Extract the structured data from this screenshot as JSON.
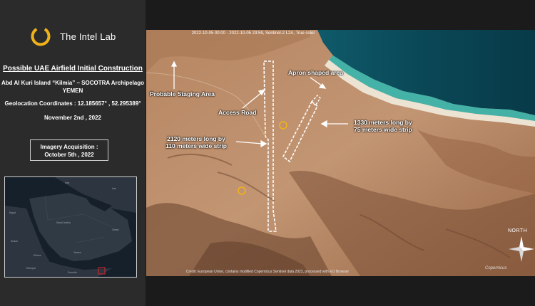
{
  "brand": {
    "name": "The Intel Lab",
    "accent": "#f0b21b"
  },
  "report": {
    "title": "Possible UAE Airfield Initial Construction",
    "location_line1": "Abd Al Kuri Island “Kilmia” – SOCOTRA Archipelago",
    "location_line2": "YEMEN",
    "coordinates": "Geolocation Coordinates : 12.185657°  , 52.295389°",
    "publication_date": "November 2nd , 2022",
    "acquisition_label": "Imagery Acquisition :",
    "acquisition_date": "October 5th , 2022"
  },
  "inset_map": {
    "labels": [
      "Egypt",
      "Saudi Arabia",
      "Yemen",
      "Oman",
      "Sudan",
      "Eritrea",
      "Ethiopia",
      "Somalia",
      "Iraq",
      "Iran"
    ],
    "marker_color": "#e0262b"
  },
  "imagery": {
    "caption": "2022-10-05 00:00 - 2022-10-05 23:59, Sentinel-2 L2A, True color",
    "credit": "Credit: European Union, contains modified Copernicus Sentinel data 2022, processed with EO Browser",
    "watermark": "Copernicus"
  },
  "annotations": {
    "staging": "Probable Staging Area",
    "access_road": "Access Road",
    "apron": "Apron shaped area",
    "strip_long_1": "2120 meters long by",
    "strip_long_2": "110 meters wide strip",
    "strip_short_1": "1330 meters long by",
    "strip_short_2": "75 meters wide strip"
  },
  "compass": {
    "label": "NORTH"
  },
  "icons": [
    "logo-ring-icon",
    "compass-rose-icon",
    "location-marker-icon"
  ]
}
